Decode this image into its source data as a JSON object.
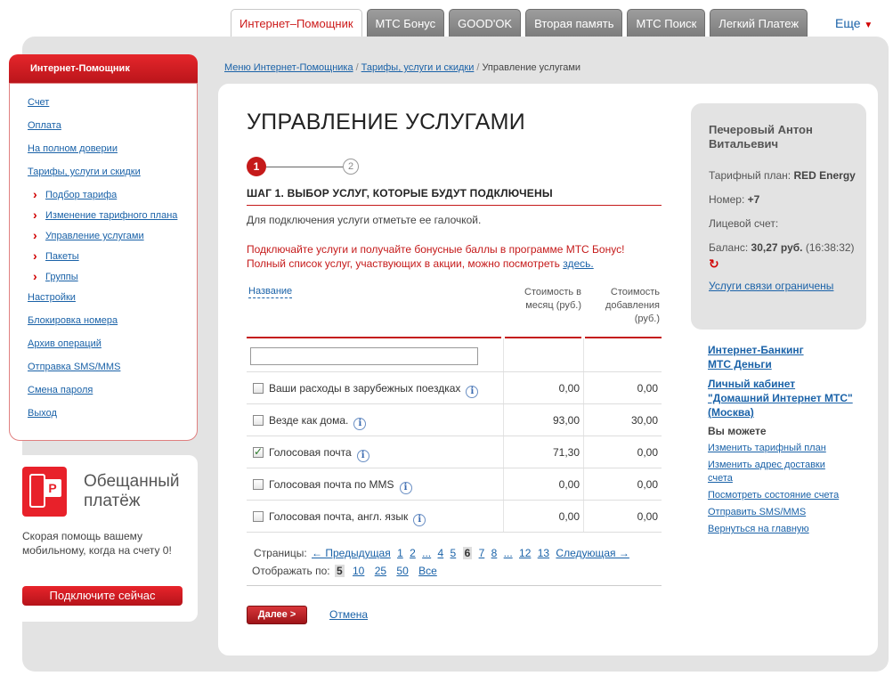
{
  "top_tabs": {
    "tabs": [
      "Интернет–Помощник",
      "МТС Бонус",
      "GOOD'OK",
      "Вторая память",
      "МТС Поиск",
      "Легкий Платеж"
    ],
    "more_label": "Еще"
  },
  "sidebar": {
    "header": "Интернет-Помощник",
    "items": [
      {
        "label": "Счет"
      },
      {
        "label": "Оплата"
      },
      {
        "label": "На полном доверии"
      },
      {
        "label": "Тарифы, услуги и скидки"
      },
      {
        "label": "Подбор тарифа"
      },
      {
        "label": "Изменение тарифного плана"
      },
      {
        "label": "Управление услугами"
      },
      {
        "label": "Пакеты"
      },
      {
        "label": "Группы"
      },
      {
        "label": "Настройки"
      },
      {
        "label": "Блокировка номера"
      },
      {
        "label": "Архив операций"
      },
      {
        "label": "Отправка SMS/MMS"
      },
      {
        "label": "Смена пароля"
      },
      {
        "label": "Выход"
      }
    ]
  },
  "promo": {
    "title": "Обещанный платёж",
    "text": "Скорая помощь вашему мобильному, когда на счету 0!",
    "button": "Подключите сейчас"
  },
  "breadcrumb": {
    "items": [
      "Меню Интернет-Помощника",
      "Тарифы, услуги и скидки"
    ],
    "current": "Управление услугами"
  },
  "main": {
    "title": "УПРАВЛЕНИЕ УСЛУГАМИ",
    "step1": "1",
    "step2": "2",
    "step_heading": "ШАГ 1. ВЫБОР УСЛУГ, КОТОРЫЕ БУДУТ ПОДКЛЮЧЕНЫ",
    "hint": "Для подключения услуги отметьте ее галочкой.",
    "bonus_line1": "Подключайте услуги и получайте бонусные баллы в программе МТС Бонус!",
    "bonus_line2": "Полный список услуг, участвующих в акции, можно посмотреть",
    "bonus_link": "здесь.",
    "table": {
      "col_name": "Название",
      "col_monthly": "Стоимость в месяц (руб.)",
      "col_add": "Стоимость добавления (руб.)",
      "filter_value": "",
      "rows": [
        {
          "name": "Ваши расходы в зарубежных поездках",
          "monthly": "0,00",
          "add": "0,00",
          "checked": false
        },
        {
          "name": "Везде как дома.",
          "monthly": "93,00",
          "add": "30,00",
          "checked": false
        },
        {
          "name": "Голосовая почта",
          "monthly": "71,30",
          "add": "0,00",
          "checked": true
        },
        {
          "name": "Голосовая почта по MMS",
          "monthly": "0,00",
          "add": "0,00",
          "checked": false
        },
        {
          "name": "Голосовая почта, англ. язык",
          "monthly": "0,00",
          "add": "0,00",
          "checked": false
        }
      ]
    },
    "pager": {
      "label": "Страницы:",
      "prev": "← Предыдущая",
      "pages_before": [
        "1",
        "2",
        "...",
        "4",
        "5"
      ],
      "current": "6",
      "pages_after": [
        "7",
        "8",
        "...",
        "12",
        "13"
      ],
      "next": "Следующая →"
    },
    "per_page": {
      "label": "Отображать по:",
      "current": "5",
      "options": [
        "10",
        "25",
        "50",
        "Все"
      ]
    },
    "next_button": "Далее >",
    "cancel_link": "Отмена"
  },
  "account": {
    "name": "Печеровый Антон Витальевич",
    "tariff_label": "Тарифный план:",
    "tariff_value": "RED Energy",
    "number_label": "Номер:",
    "number_value": "+7",
    "account_label": "Лицевой счет:",
    "balance_label": "Баланс:",
    "balance_value": "30,27 руб.",
    "balance_time": "(16:38:32)",
    "status": "Услуги связи ограничены"
  },
  "right_links": {
    "banking_line1": "Интернет-Банкинг",
    "banking_line2": "МТС Деньги",
    "cabinet_line1": "Личный кабинет",
    "cabinet_line2": "\"Домашний Интернет МТС\"",
    "cabinet_line3": "(Москва)",
    "can_do": "Вы можете",
    "actions": [
      "Изменить тарифный план",
      "Изменить адрес доставки счета",
      "Посмотреть состояние счета",
      "Отправить SMS/MMS",
      "Вернуться на главную"
    ]
  },
  "colors": {
    "accent_red": "#c51a1a",
    "link_blue": "#1a62a8",
    "frame_gray": "#e3e3e3"
  }
}
